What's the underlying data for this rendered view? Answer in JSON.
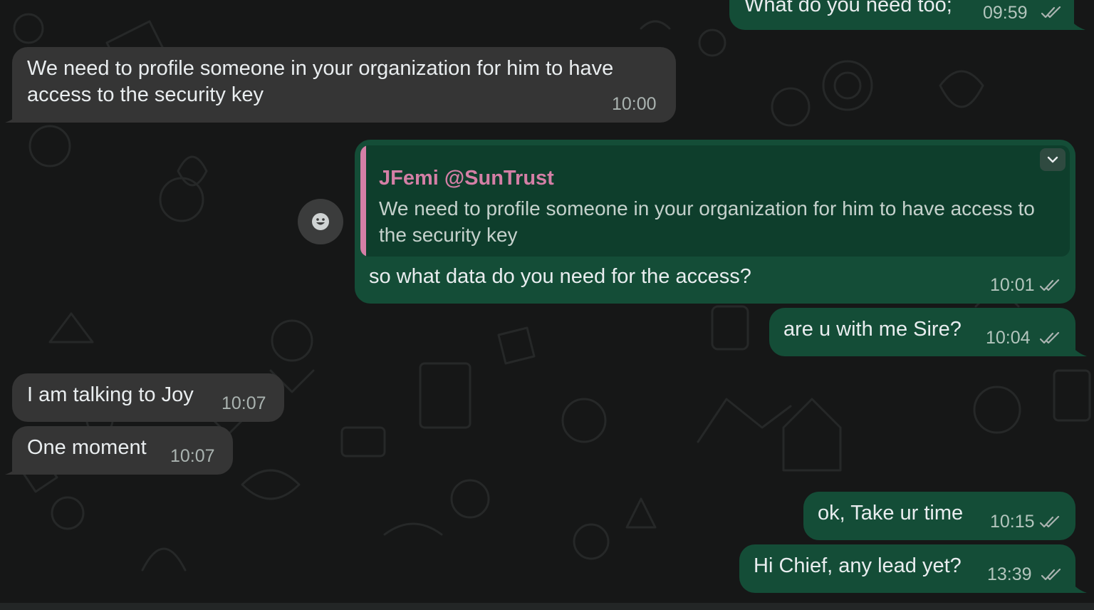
{
  "messages": [
    {
      "id": "m1",
      "direction": "outgoing",
      "text": "What do you need too;",
      "time": "09:59",
      "status": "read"
    },
    {
      "id": "m2",
      "direction": "incoming",
      "text": "We need to profile someone in your organization for him to have access to the security key",
      "time": "10:00"
    },
    {
      "id": "m3",
      "direction": "outgoing",
      "quote": {
        "author": "JFemi @SunTrust",
        "text": "We need to profile someone in your organization for him to have access to the security key"
      },
      "text": "so what data do you need for the access?",
      "time": "10:01",
      "status": "read"
    },
    {
      "id": "m4",
      "direction": "outgoing",
      "text": "are u with me Sire?",
      "time": "10:04",
      "status": "read"
    },
    {
      "id": "m5",
      "direction": "incoming",
      "text": "I am talking to Joy",
      "time": "10:07"
    },
    {
      "id": "m6",
      "direction": "incoming",
      "text": "One moment",
      "time": "10:07"
    },
    {
      "id": "m7",
      "direction": "outgoing",
      "text": "ok, Take ur time",
      "time": "10:15",
      "status": "read"
    },
    {
      "id": "m8",
      "direction": "outgoing",
      "text": "Hi Chief, any lead yet?",
      "time": "13:39",
      "status": "read"
    }
  ],
  "icons": {
    "read_receipt": "double-check-icon",
    "message_menu": "chevron-down-icon",
    "reaction": "smiley-icon"
  },
  "colors": {
    "background": "#161717",
    "incoming_bubble": "#353535",
    "outgoing_bubble": "#144d37",
    "quote_accent": "#d47fa6",
    "text": "#e9edef"
  }
}
